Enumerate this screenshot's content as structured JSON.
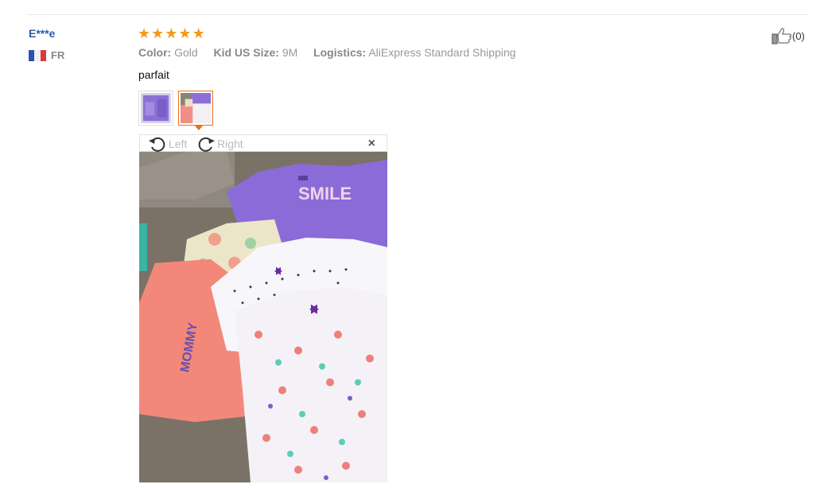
{
  "review": {
    "user_name": "E***e",
    "country_code": "FR",
    "rating": 5,
    "attributes": {
      "color_label": "Color:",
      "color_value": "Gold",
      "size_label": "Kid US Size:",
      "size_value": "9M",
      "logistics_label": "Logistics:",
      "logistics_value": "AliExpress Standard Shipping"
    },
    "text": "parfait",
    "likes": "(0)"
  },
  "viewer": {
    "rotate_left": "Left",
    "rotate_right": "Right",
    "close": "×"
  },
  "colors": {
    "accent": "#e8711e",
    "star": "#f29a17",
    "username": "#2c5ca8"
  },
  "icons": {
    "flag": "france-flag-icon",
    "rotate_left": "rotate-left-icon",
    "rotate_right": "rotate-right-icon",
    "close": "close-icon",
    "like": "thumbs-up-icon"
  }
}
